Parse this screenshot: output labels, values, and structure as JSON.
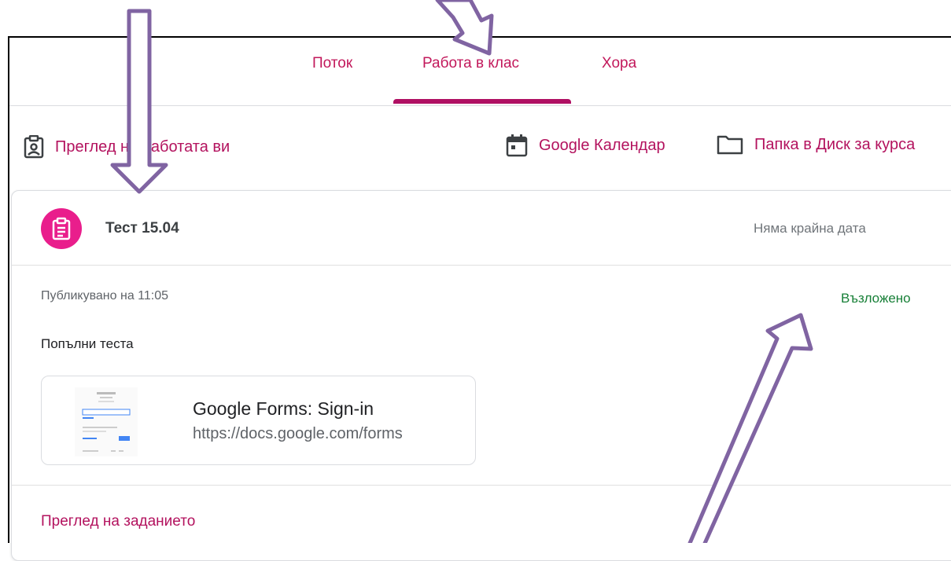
{
  "tabs": [
    {
      "label": "Поток",
      "active": false
    },
    {
      "label": "Работа в клас",
      "active": true
    },
    {
      "label": "Хора",
      "active": false
    }
  ],
  "toolbar": {
    "review_work": "Преглед на работата ви",
    "calendar": "Google Календар",
    "drive_folder": "Папка в Диск за курса"
  },
  "assignment": {
    "title": "Тест 15.04",
    "due": "Няма крайна дата",
    "posted": "Публикувано на 11:05",
    "status": "Възложено",
    "instructions": "Попълни теста",
    "attachment": {
      "title": "Google Forms: Sign-in",
      "url": "https://docs.google.com/forms"
    },
    "review_link": "Преглед на заданието"
  },
  "colors": {
    "accent": "#b3125e",
    "tab_text": "#c2185b",
    "icon_bg": "#e91e8c",
    "status": "#188038",
    "arrow": "#8064a2"
  },
  "icons": [
    "assignment-review-icon",
    "calendar-icon",
    "folder-icon",
    "assignment-icon"
  ]
}
